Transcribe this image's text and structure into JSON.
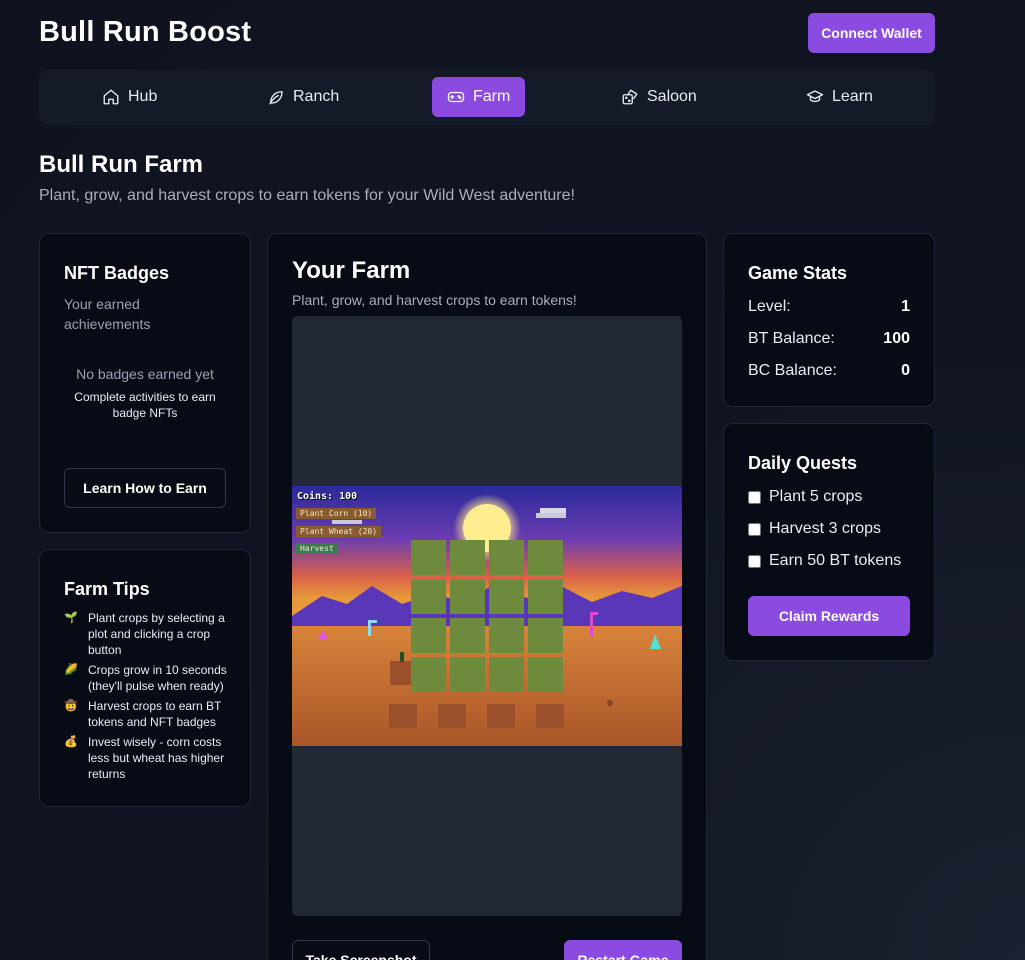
{
  "app": {
    "title": "Bull Run Boost",
    "connect_label": "Connect Wallet"
  },
  "nav": {
    "items": [
      {
        "label": "Hub",
        "icon": "home-icon"
      },
      {
        "label": "Ranch",
        "icon": "leaf-icon"
      },
      {
        "label": "Farm",
        "icon": "gamepad-icon",
        "active": true
      },
      {
        "label": "Saloon",
        "icon": "dice-icon"
      },
      {
        "label": "Learn",
        "icon": "graduation-cap-icon"
      }
    ]
  },
  "page": {
    "title": "Bull Run Farm",
    "subtitle": "Plant, grow, and harvest crops to earn tokens for your Wild West adventure!"
  },
  "badges": {
    "title": "NFT Badges",
    "subtitle": "Your earned achievements",
    "empty": "No badges earned yet",
    "hint": "Complete activities to earn badge NFTs",
    "button": "Learn How to Earn"
  },
  "tips": {
    "title": "Farm Tips",
    "items": [
      {
        "icon": "🌱",
        "text": "Plant crops by selecting a plot and clicking a crop button"
      },
      {
        "icon": "🌽",
        "text": "Crops grow in 10 seconds (they'll pulse when ready)"
      },
      {
        "icon": "🤠",
        "text": "Harvest crops to earn BT tokens and NFT badges"
      },
      {
        "icon": "💰",
        "text": "Invest wisely - corn costs less but wheat has higher returns"
      }
    ]
  },
  "farm": {
    "title": "Your Farm",
    "subtitle": "Plant, grow, and harvest crops to earn tokens!",
    "game": {
      "coins": "Coins: 100",
      "plant_corn": "Plant Corn (10)",
      "plant_wheat": "Plant Wheat (20)",
      "harvest": "Harvest"
    },
    "screenshot_label": "Take Screenshot",
    "restart_label": "Restart Game"
  },
  "stats": {
    "title": "Game Stats",
    "rows": [
      {
        "label": "Level:",
        "value": "1"
      },
      {
        "label": "BT Balance:",
        "value": "100"
      },
      {
        "label": "BC Balance:",
        "value": "0"
      }
    ]
  },
  "quests": {
    "title": "Daily Quests",
    "items": [
      {
        "label": "Plant 5 crops",
        "checked": false
      },
      {
        "label": "Harvest 3 crops",
        "checked": false
      },
      {
        "label": "Earn 50 BT tokens",
        "checked": false
      }
    ],
    "claim_label": "Claim Rewards"
  },
  "colors": {
    "accent": "#8b4ae0",
    "card_bg": "#070b16",
    "page_bg": "#111522",
    "plot": "#6e8b3d"
  }
}
